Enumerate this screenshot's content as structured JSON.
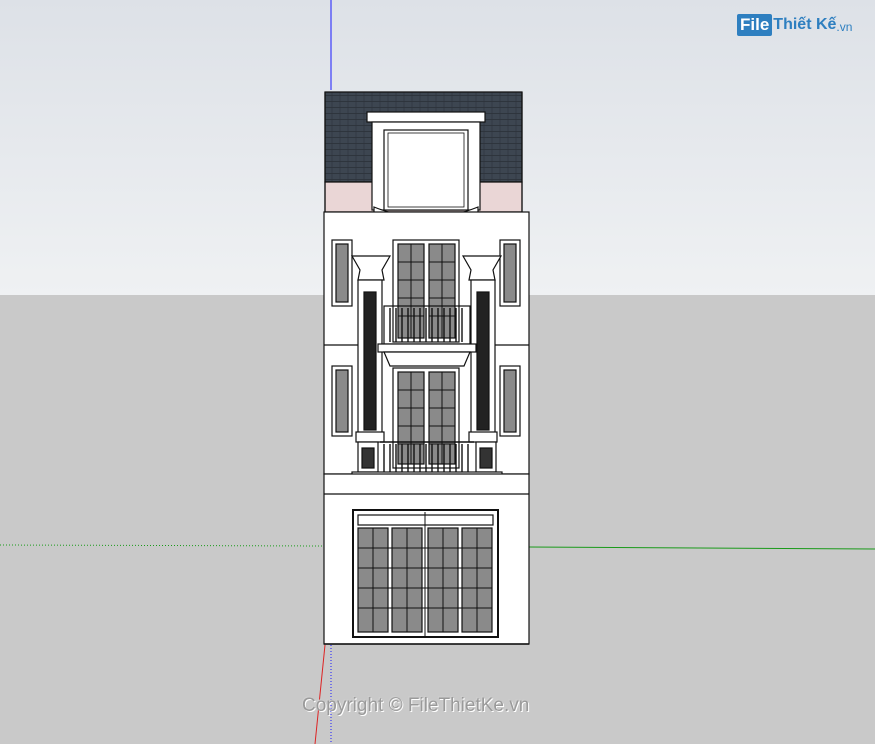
{
  "watermark": {
    "logo_file": "File",
    "logo_name": "Thiết Kế",
    "logo_domain": ".vn",
    "copyright": "Copyright © FileThietKe.vn"
  },
  "colors": {
    "sky_top": "#dde1e7",
    "sky_bottom": "#eef0f3",
    "ground": "#c9c9c9",
    "roof": "#3c4550",
    "pink_band": "#ead6d6",
    "wall": "#ffffff",
    "glass": "#8a8a8a",
    "axis_blue": "#1a1aff",
    "axis_green": "#1a9a1a",
    "axis_red": "#dd2222",
    "brand": "#2e7fc0"
  },
  "icons": {
    "axis": "model-axes",
    "model": "townhouse-facade-3d-model"
  }
}
